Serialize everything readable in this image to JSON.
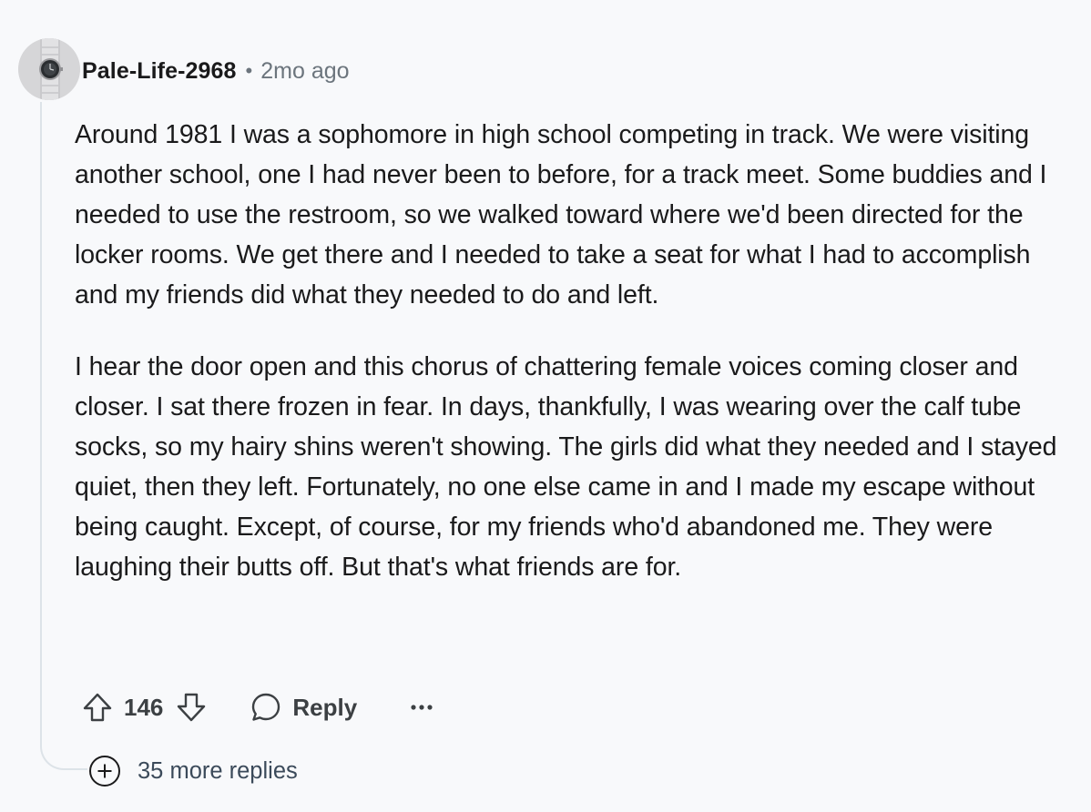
{
  "comment": {
    "author": "Pale-Life-2968",
    "separator": "•",
    "timestamp": "2mo ago",
    "avatar_icon": "watch-avatar",
    "paragraphs": [
      "Around 1981 I was a sophomore in high school competing in track. We were visiting another school, one I had never been to before, for a track meet. Some buddies and I needed to use the restroom, so we walked toward where we'd been directed for the locker rooms. We get there and I needed to take a seat for what I had to accomplish and my friends did what they needed to do and left.",
      "I hear the door open and this chorus of chattering female voices coming closer and closer. I sat there frozen in fear. In days, thankfully, I was wearing over the calf tube socks, so my hairy shins weren't showing. The girls did what they needed and I stayed quiet, then they left. Fortunately, no one else came in and I made my escape without being caught. Except, of course, for my friends who'd abandoned me. They were laughing their butts off. But that's what friends are for."
    ],
    "actions": {
      "upvote_icon": "arrow-up-icon",
      "score": "146",
      "downvote_icon": "arrow-down-icon",
      "reply_icon": "speech-bubble-icon",
      "reply_label": "Reply",
      "more_icon": "ellipsis-icon",
      "more_label": "•••"
    },
    "more_replies": {
      "icon": "plus-circle-icon",
      "label": "35 more replies"
    }
  },
  "colors": {
    "background": "#f8f9fb",
    "text": "#1a1a1b",
    "meta": "#6c757d",
    "action": "#3c4043",
    "thread_line": "#dde3e8"
  }
}
